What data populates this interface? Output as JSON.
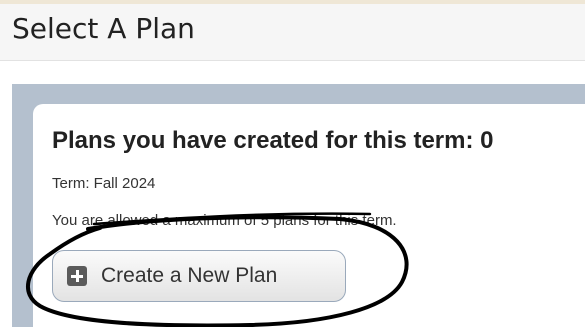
{
  "header": {
    "title": "Select A Plan"
  },
  "plans_card": {
    "heading": "Plans you have created for this term: 0",
    "term_text": "Term: Fall 2024",
    "limit_text": "You are allowed a maximum of 5 plans for this term.",
    "create_button_label": "Create a New Plan",
    "plans_created_count": 0,
    "max_plans": 5
  },
  "icons": {
    "create_button_icon": "plus-square-icon"
  },
  "colors": {
    "header_bg": "#f6f6f6",
    "panel_bg": "#b4c0ce",
    "button_border": "#9aa9bb",
    "annotation_stroke": "#000000"
  }
}
